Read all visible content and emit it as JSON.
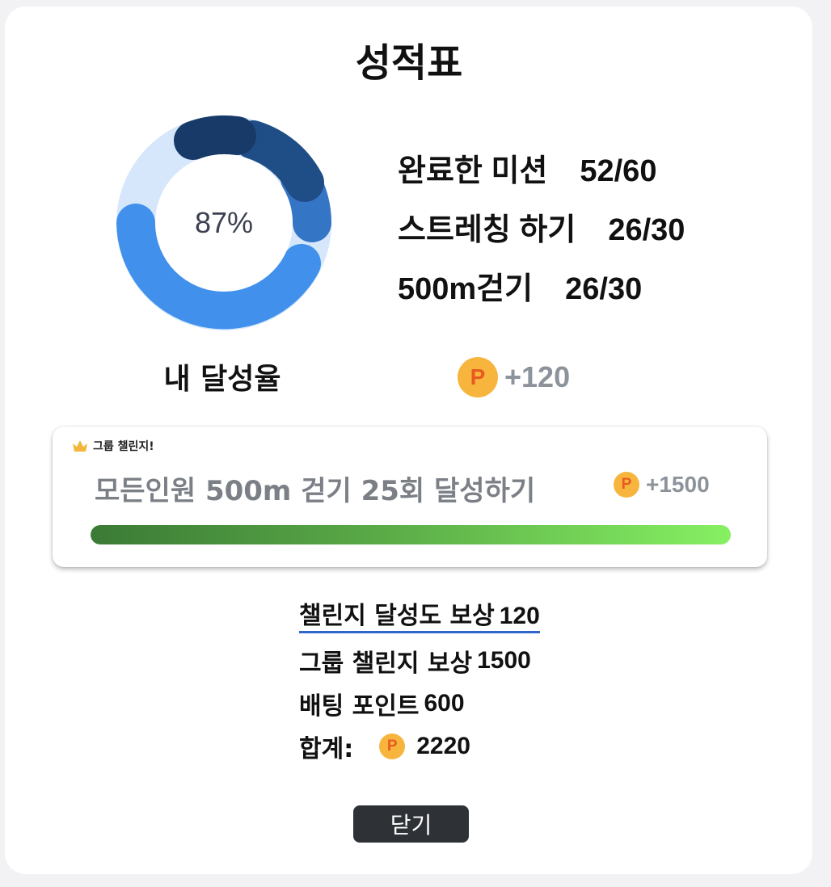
{
  "title": "성적표",
  "achievement": {
    "percent_label": "87%",
    "label": "내 달성율",
    "percent": 87,
    "colors": {
      "track": "#d6e7fb",
      "light": "#4090ec",
      "mid": "#2f6fc0",
      "dark": "#1e4a82",
      "darkest": "#173a69"
    }
  },
  "stats": [
    {
      "label": "완료한 미션",
      "value": "52/60"
    },
    {
      "label": "스트레칭 하기",
      "value": "26/30"
    },
    {
      "label": "500m걷기",
      "value": "26/30"
    }
  ],
  "reward": {
    "coin_icon": "P",
    "amount": "+120"
  },
  "group_challenge": {
    "header": "그룹 챌린지!",
    "mission": "모든인원 500m 걷기 25회 달성하기",
    "coin_icon": "P",
    "reward": "+1500",
    "progress": 1.0
  },
  "summary": {
    "challenge_reward_label": "챌린지 달성도 보상",
    "challenge_reward_value": "120",
    "group_reward_label": "그룹 챌린지 보상",
    "group_reward_value": "1500",
    "betting_label": "배팅 포인트",
    "betting_value": "600",
    "total_label": "합계:",
    "total_coin": "P",
    "total_value": "2220"
  },
  "close_label": "닫기"
}
